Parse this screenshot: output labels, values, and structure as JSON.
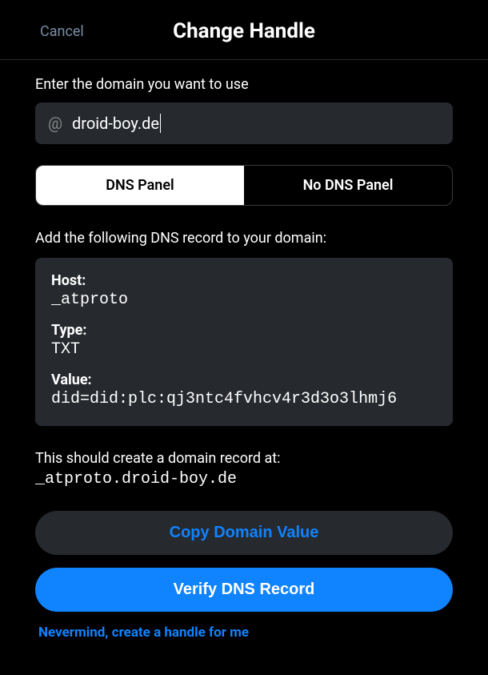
{
  "header": {
    "cancel": "Cancel",
    "title": "Change Handle"
  },
  "domain": {
    "prompt": "Enter the domain you want to use",
    "at": "@",
    "value": "droid-boy.de"
  },
  "tabs": {
    "dns_panel": "DNS Panel",
    "no_dns_panel": "No DNS Panel"
  },
  "dns": {
    "instruction": "Add the following DNS record to your domain:",
    "host_label": "Host:",
    "host_value": "_atproto",
    "type_label": "Type:",
    "type_value": "TXT",
    "value_label": "Value:",
    "value_value": "did=did:plc:qj3ntc4fvhcv4r3d3o3lhmj6"
  },
  "result": {
    "text": "This should create a domain record at:",
    "domain": "_atproto.droid-boy.de"
  },
  "buttons": {
    "copy": "Copy Domain Value",
    "verify": "Verify DNS Record",
    "nevermind": "Nevermind, create a handle for me"
  }
}
